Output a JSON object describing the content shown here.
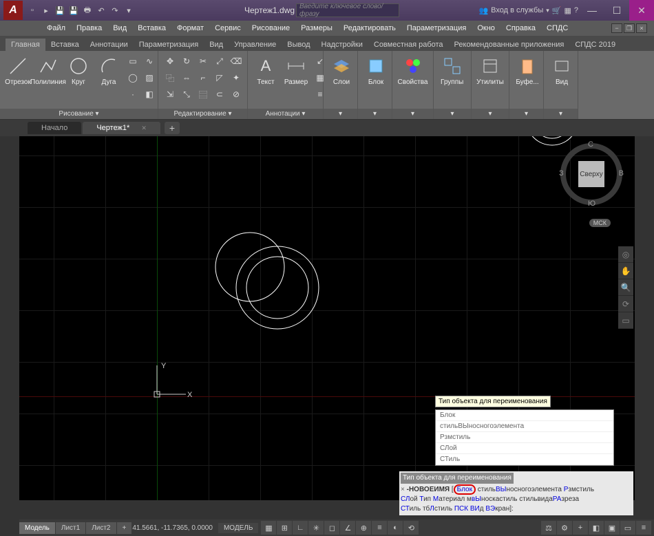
{
  "app": {
    "logo": "A",
    "title": "Чертеж1.dwg"
  },
  "search": {
    "placeholder": "Введите ключевое слово/фразу"
  },
  "title_right": {
    "login": "Вход в службы"
  },
  "menubar": [
    "Файл",
    "Правка",
    "Вид",
    "Вставка",
    "Формат",
    "Сервис",
    "Рисование",
    "Размеры",
    "Редактировать",
    "Параметризация",
    "Окно",
    "Справка",
    "СПДС"
  ],
  "ribbon_tabs": [
    "Главная",
    "Вставка",
    "Аннотации",
    "Параметризация",
    "Вид",
    "Управление",
    "Вывод",
    "Надстройки",
    "Совместная работа",
    "Рекомендованные приложения",
    "СПДС 2019"
  ],
  "panels": {
    "draw": {
      "title": "Рисование ▾",
      "btns": [
        "Отрезок",
        "Полилиния",
        "Круг",
        "Дуга"
      ]
    },
    "modify": {
      "title": "Редактирование ▾"
    },
    "annot": {
      "title": "Аннотации ▾",
      "btns": [
        "Текст",
        "Размер"
      ]
    },
    "layers": {
      "title": "Слои"
    },
    "block": {
      "title": "Блок"
    },
    "props": {
      "title": "Свойства"
    },
    "groups": {
      "title": "Группы"
    },
    "utils": {
      "title": "Утилиты"
    },
    "clip": {
      "title": "Буфе..."
    },
    "view": {
      "title": "Вид"
    }
  },
  "file_tabs": {
    "start": "Начало",
    "doc": "Чертеж1*"
  },
  "viewcube": {
    "top": "Сверху",
    "n": "С",
    "s": "Ю",
    "e": "В",
    "w": "З",
    "wcs": "МСК"
  },
  "ucs": {
    "x": "X",
    "y": "Y"
  },
  "cmd_tooltip": "Тип объекта для переименования",
  "cmd_list": [
    "Блок",
    "стильВЫносногоэлемента",
    "Рзмстиль",
    "СЛой",
    "СТиль"
  ],
  "cmd_hint": "Тип объекта для переименования",
  "cmd_prompt_prefix": "-НОВОЕИМЯ",
  "cmd_block": "Блок",
  "cmd_options_1a": "стиль",
  "cmd_options_1b": "ВЫ",
  "cmd_options_1c": "носногоэлемента ",
  "cmd_options_1d": "Р",
  "cmd_options_1e": "змстиль",
  "cmd_line2_a": "СЛ",
  "cmd_line2_b": "ой ",
  "cmd_line2_c": "Т",
  "cmd_line2_d": "ип ",
  "cmd_line2_e": "М",
  "cmd_line2_f": "атериал м",
  "cmd_line2_g": "вЫ",
  "cmd_line2_h": "носкастиль стильвида",
  "cmd_line2_i": "РА",
  "cmd_line2_j": "зреза",
  "cmd_line3_a": "СТ",
  "cmd_line3_b": "иль тб",
  "cmd_line3_c": "Л",
  "cmd_line3_d": "стиль ",
  "cmd_line3_e": "ПСК ВИ",
  "cmd_line3_f": "д ",
  "cmd_line3_g": "ВЭ",
  "cmd_line3_h": "кран]:",
  "status": {
    "tabs": [
      "Модель",
      "Лист1",
      "Лист2"
    ],
    "coords": "41.5661, -11.7365, 0.0000",
    "model_btn": "МОДЕЛЬ"
  }
}
